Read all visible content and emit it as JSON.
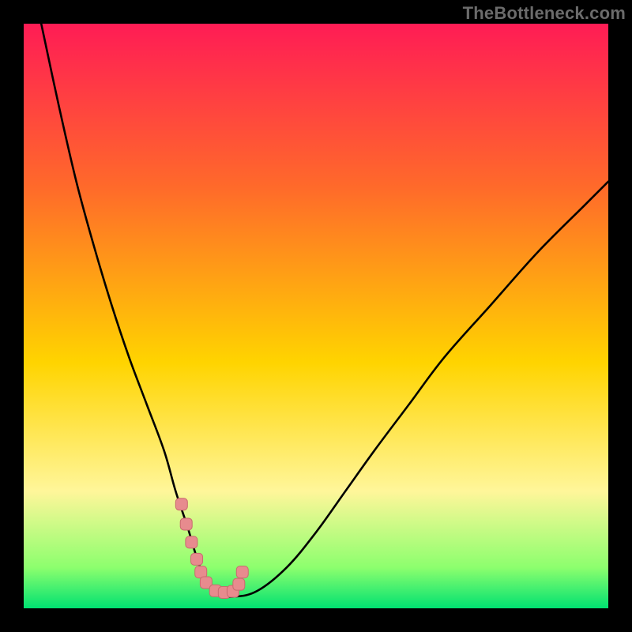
{
  "watermark": "TheBottleneck.com",
  "colors": {
    "gradient_top": "#ff1c55",
    "gradient_mid1": "#ff6a2a",
    "gradient_mid2": "#ffd400",
    "gradient_mid3": "#fff69a",
    "gradient_bottom_band": "#8dff6e",
    "gradient_bottom": "#00e171",
    "curve": "#000000",
    "marker_fill": "#e78b8e",
    "marker_stroke": "#c96a6f"
  },
  "chart_data": {
    "type": "line",
    "title": "",
    "xlabel": "",
    "ylabel": "",
    "xlim": [
      0,
      100
    ],
    "ylim": [
      0,
      100
    ],
    "grid": false,
    "legend": false,
    "series": [
      {
        "name": "bottleneck-curve",
        "x": [
          3,
          6,
          9,
          12,
          15,
          18,
          21,
          24,
          26,
          28,
          29.5,
          31,
          33,
          36,
          40,
          45,
          50,
          55,
          60,
          66,
          72,
          80,
          88,
          96,
          100
        ],
        "y": [
          100,
          86,
          73,
          62,
          52,
          43,
          35,
          27,
          20,
          14,
          9,
          5,
          2.5,
          2,
          3,
          7,
          13,
          20,
          27,
          35,
          43,
          52,
          61,
          69,
          73
        ]
      }
    ],
    "markers": {
      "name": "highlight-cluster",
      "x": [
        27.0,
        27.8,
        28.7,
        29.6,
        30.3,
        31.2,
        32.8,
        34.3,
        35.8,
        36.8,
        37.4
      ],
      "y": [
        17.8,
        14.4,
        11.3,
        8.4,
        6.2,
        4.4,
        3.0,
        2.7,
        2.9,
        4.1,
        6.2
      ]
    }
  }
}
